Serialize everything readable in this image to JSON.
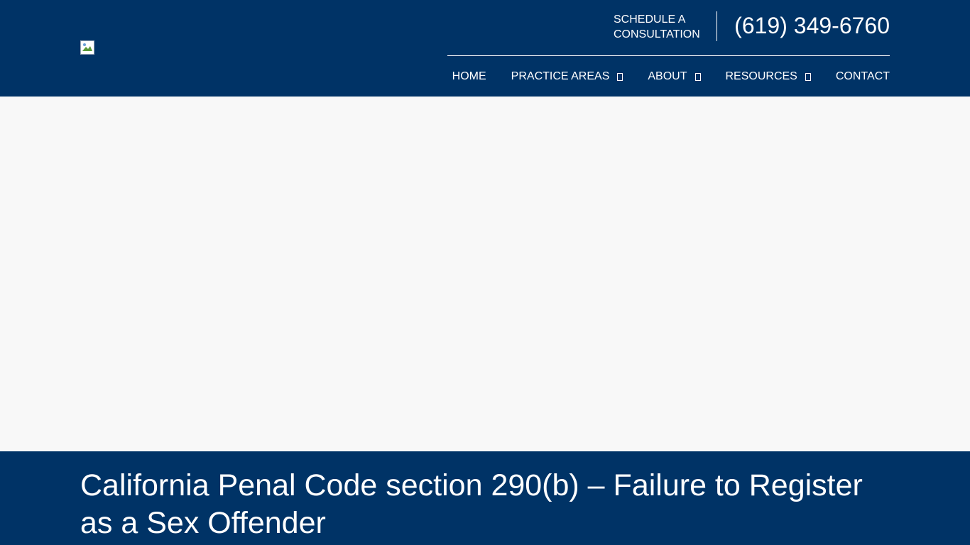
{
  "header": {
    "logo_alt": "",
    "schedule_line1": "SCHEDULE A",
    "schedule_line2": "CONSULTATION",
    "phone": "(619) 349-6760",
    "background_color": "#003366"
  },
  "nav": {
    "items": [
      {
        "label": "HOME",
        "has_dropdown": false
      },
      {
        "label": "PRACTICE AREAS",
        "has_dropdown": true
      },
      {
        "label": "ABOUT",
        "has_dropdown": true
      },
      {
        "label": "RESOURCES",
        "has_dropdown": true
      },
      {
        "label": "CONTACT",
        "has_dropdown": false
      }
    ]
  },
  "hero": {
    "background_color": "#f8f8f8"
  },
  "page": {
    "title": "California Penal Code section 290(b) – Failure to Register as a Sex Offender"
  },
  "icons": {
    "dropdown_caret": "chevron-down-icon",
    "logo": "broken-image-icon"
  }
}
